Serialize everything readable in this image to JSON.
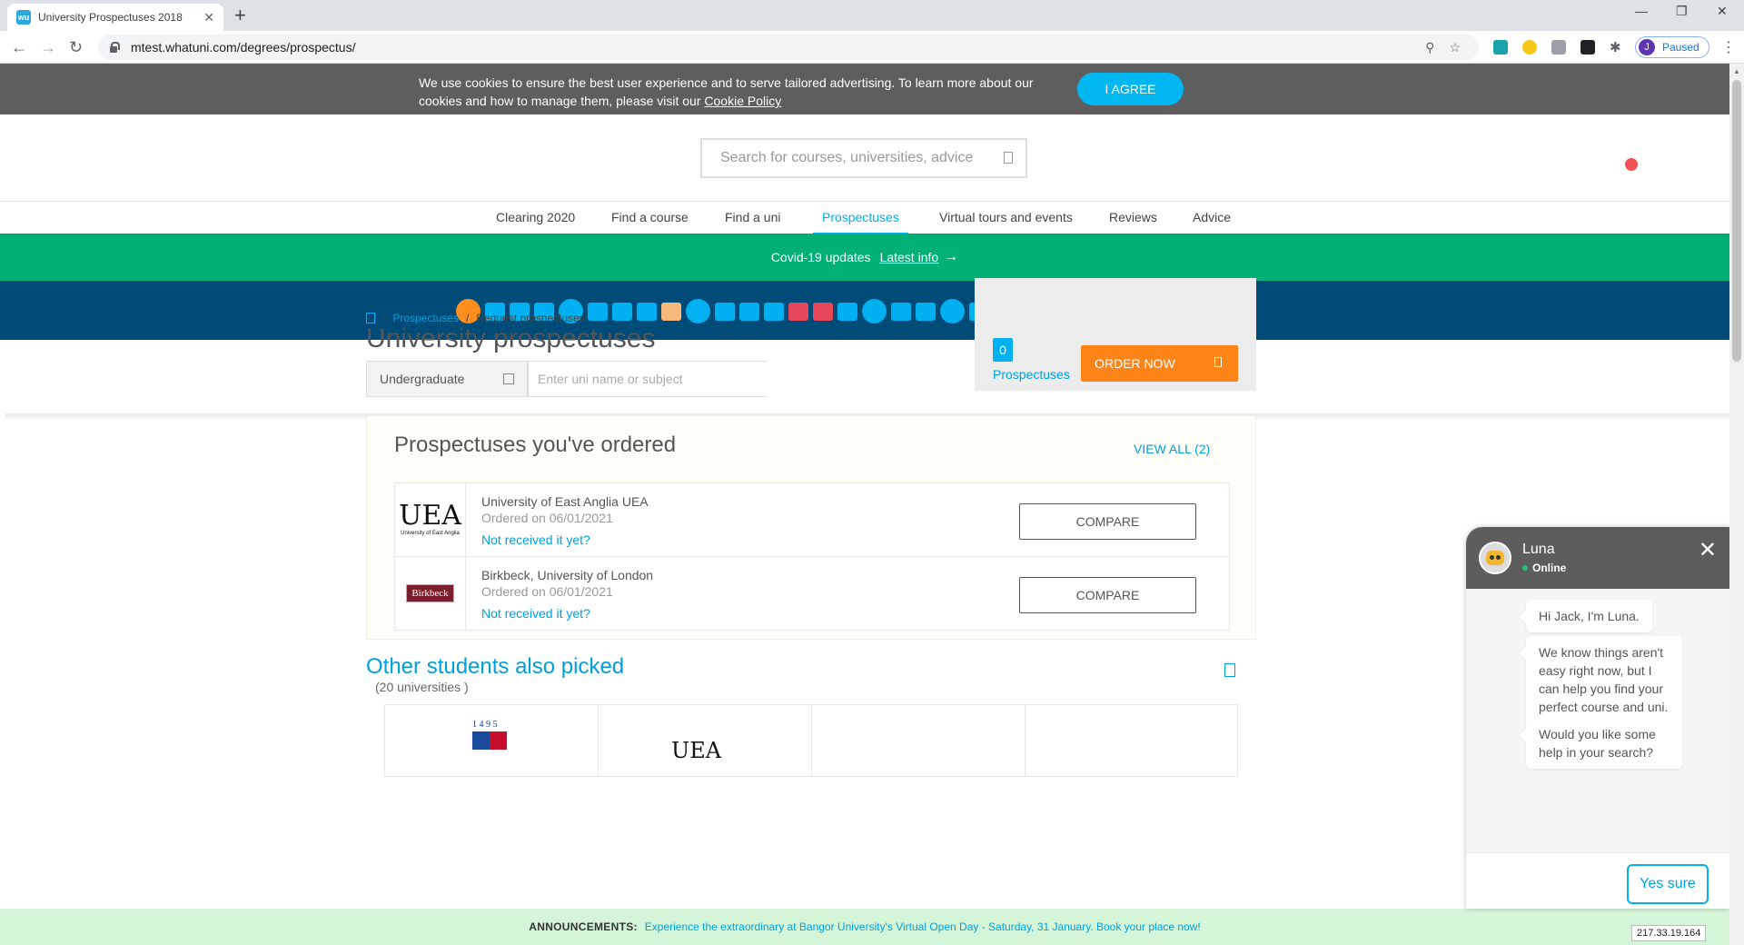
{
  "browser": {
    "tab_title": "University Prospectuses 2018",
    "tab_close": "✕",
    "new_tab": "+",
    "favicon_label": "wu",
    "url": "mtest.whatuni.com/degrees/prospectus/",
    "profile_initial": "J",
    "profile_status": "Paused",
    "back": "←",
    "forward": "→",
    "reload": "↻",
    "menu": "⋮",
    "minimize": "—",
    "restore": "❐",
    "close": "✕",
    "location_icon": "⚲",
    "star": "☆",
    "extensions_icon": "✱"
  },
  "cookie": {
    "text": "We use cookies to ensure the best user experience and to serve tailored advertising. To learn more about our cookies and how to manage them, please visit our",
    "link": "Cookie Policy",
    "button": "I AGREE"
  },
  "search": {
    "placeholder": "Search for courses, universities, advice"
  },
  "nav": {
    "items": [
      "Clearing 2020",
      "Find a course",
      "Find a uni",
      "Prospectuses",
      "Virtual tours and events",
      "Reviews",
      "Advice"
    ],
    "active": "Prospectuses"
  },
  "covid": {
    "text": "Covid-19 updates",
    "link": "Latest info",
    "arrow": "→"
  },
  "breadcrumb": {
    "sep1": "/",
    "link": "Prospectuses",
    "sep2": "/",
    "current": "Request prospectuses"
  },
  "page": {
    "title": "University prospectuses",
    "study_level": "Undergraduate",
    "search_placeholder": "Enter uni name or subject"
  },
  "basket": {
    "count": "0",
    "label": "Prospectuses",
    "order_button": "ORDER NOW"
  },
  "ordered": {
    "heading": "Prospectuses you've ordered",
    "view_all": "VIEW ALL (2)",
    "rows": [
      {
        "name": "University of East Anglia UEA",
        "date": "Ordered on 06/01/2021",
        "not_received": "Not received it yet?",
        "compare": "COMPARE",
        "logo_text": "UEA",
        "logo_sub": "University of East Anglia"
      },
      {
        "name": "Birkbeck, University of London",
        "date": "Ordered on 06/01/2021",
        "not_received": "Not received it yet?",
        "compare": "COMPARE",
        "logo_text": "Birkbeck"
      }
    ]
  },
  "other": {
    "heading": "Other students also picked",
    "count": "(20 universities )",
    "card1_year": "1 4 9 5",
    "card2_logo": "UEA"
  },
  "announcement": {
    "label": "ANNOUNCEMENTS:",
    "message": "Experience the extraordinary at Bangor University's Virtual Open Day - Saturday, 31 January. Book your place now!"
  },
  "ip": "217.33.19.164",
  "chat": {
    "agent_name": "Luna",
    "status": "Online",
    "close": "✕",
    "messages": [
      "Hi Jack, I'm Luna.",
      "We know things aren't easy right now, but I can help you find your perfect course and uni.",
      "Would you like some help in your search?"
    ],
    "reply_button": "Yes sure"
  }
}
